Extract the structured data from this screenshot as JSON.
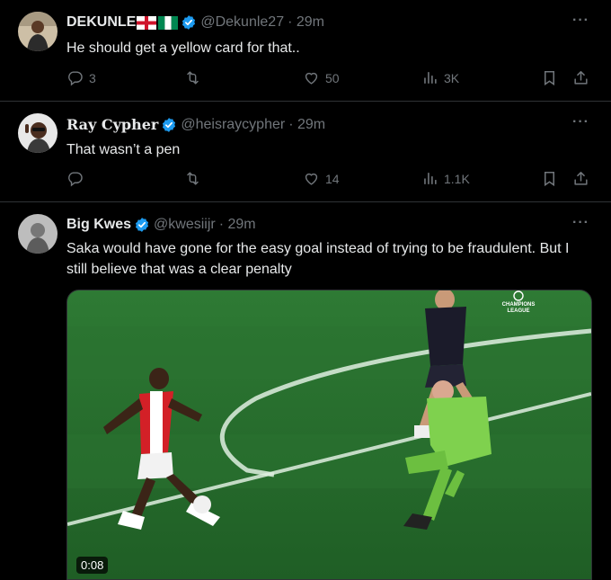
{
  "tweets": [
    {
      "name": "DEKUNLE",
      "handle": "@Dekunle27",
      "time": "· 29m",
      "text": "He should get a yellow card for that..",
      "replies": "3",
      "likes": "50",
      "views": "3K"
    },
    {
      "name": "Ray Cypher",
      "handle": "@heisraycypher",
      "time": "· 29m",
      "text": "That wasn’t a pen",
      "replies": "",
      "likes": "14",
      "views": "1.1K"
    },
    {
      "name": "Big Kwes",
      "handle": "@kwesiijr",
      "time": "· 29m",
      "text": "Saka would have gone for the easy goal instead of trying to be fraudulent. But I still believe that was a clear penalty",
      "video": {
        "duration": "0:08",
        "watermark_line1": "CHAMPIONS",
        "watermark_line2": "LEAGUE"
      }
    }
  ],
  "icons": {
    "more": "more-icon",
    "verified": "verified-badge-icon",
    "reply": "reply-icon",
    "retweet": "retweet-icon",
    "like": "like-icon",
    "views": "views-icon",
    "bookmark": "bookmark-icon",
    "share": "share-icon"
  },
  "colors": {
    "background": "#000000",
    "text": "#e7e9ea",
    "muted": "#71767b",
    "verified": "#1d9bf0",
    "divider": "#2f3336"
  }
}
